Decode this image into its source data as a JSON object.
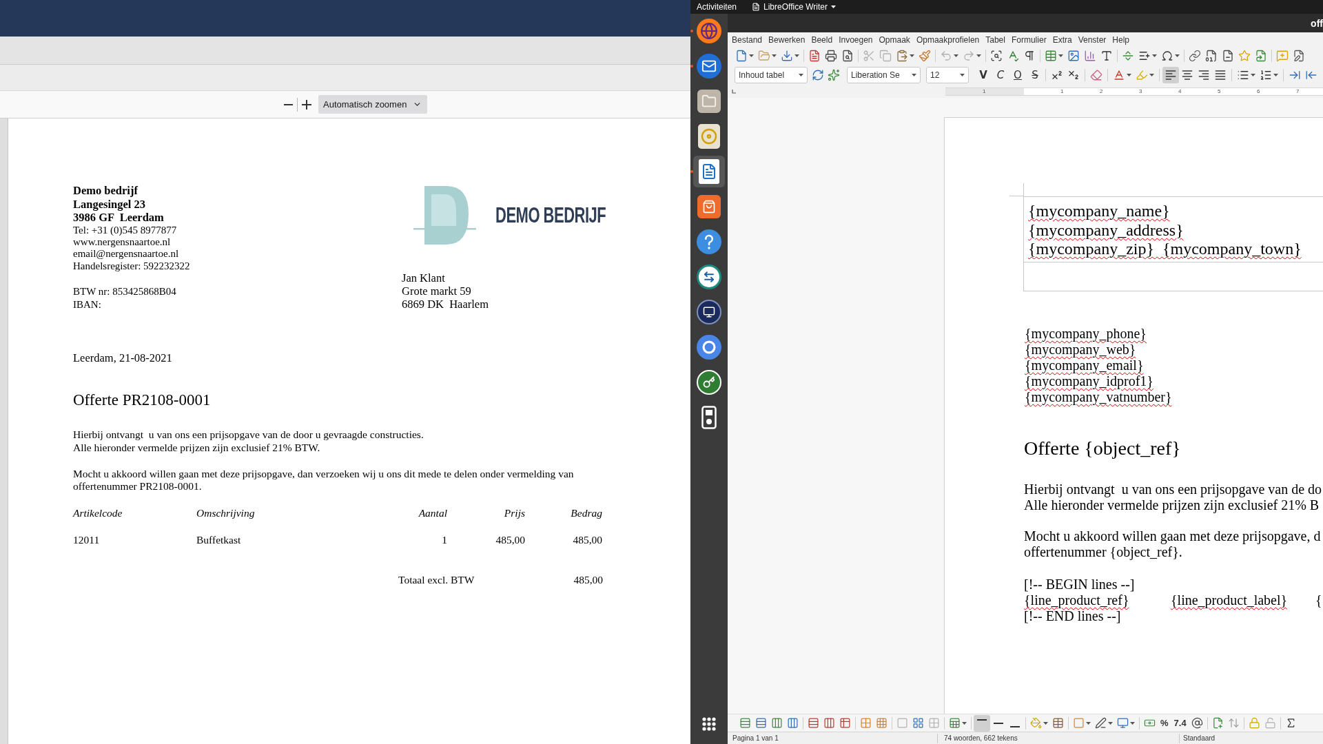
{
  "pdf_viewer": {
    "zoom_select": "Automatisch zoomen",
    "document": {
      "sender_lines": [
        {
          "text": "Demo bedrijf",
          "bold": true
        },
        {
          "text": "Langesingel 23",
          "bold": true
        },
        {
          "text": "3986 GF  Leerdam",
          "bold": true
        },
        {
          "text": "Tel: +31 (0)545 8977877",
          "bold": false
        },
        {
          "text": "www.nergensnaartoe.nl",
          "bold": false
        },
        {
          "text": "email@nergensnaartoe.nl",
          "bold": false
        },
        {
          "text": "Handelsregister: 592232322",
          "bold": false
        }
      ],
      "tax_lines": [
        "BTW nr: 853425868B04",
        "IBAN:"
      ],
      "logo_text": "DEMO BEDRIJF",
      "recipient_lines": [
        "Jan Klant",
        "Grote markt 59",
        "6869 DK  Haarlem"
      ],
      "date_line": "Leerdam, 21-08-2021",
      "title": "Offerte PR2108-0001",
      "paragraphs": [
        [
          "Hierbij ontvangt  u van ons een prijsopgave van de door u gevraagde constructies.",
          "Alle hieronder vermelde prijzen zijn exclusief 21% BTW."
        ],
        [
          "Mocht u akkoord willen gaan met deze prijsopgave, dan verzoeken wij u ons dit mede te delen onder vermelding van",
          "offertenummer PR2108-0001."
        ]
      ],
      "table": {
        "columns": [
          "Artikelcode",
          "Omschrijving",
          "Aantal",
          "Prijs",
          "Bedrag"
        ],
        "rows": [
          [
            "12011",
            "Buffetkast",
            "1",
            "485,00",
            "485,00"
          ]
        ],
        "total": {
          "label": "Totaal excl. BTW",
          "value": "485,00"
        }
      }
    }
  },
  "top_bar": {
    "activities": "Activiteiten",
    "app_menu": "LibreOffice Writer"
  },
  "dock": [
    {
      "kind": "browser",
      "running": true,
      "selected": false
    },
    {
      "kind": "mail",
      "running": true,
      "selected": false
    },
    {
      "kind": "files",
      "running": false,
      "selected": false
    },
    {
      "kind": "music",
      "running": false,
      "selected": false
    },
    {
      "kind": "writer",
      "running": true,
      "selected": true
    },
    {
      "kind": "store",
      "running": false,
      "selected": false
    },
    {
      "kind": "help",
      "running": false,
      "selected": false
    },
    {
      "kind": "remote",
      "running": false,
      "selected": false
    },
    {
      "kind": "commander",
      "running": false,
      "selected": false
    },
    {
      "kind": "web",
      "running": false,
      "selected": false
    },
    {
      "kind": "keys",
      "running": false,
      "selected": false
    },
    {
      "kind": "player",
      "running": false,
      "selected": false
    }
  ],
  "writer": {
    "title": "off",
    "menu": [
      "Bestand",
      "Bewerken",
      "Beeld",
      "Invoegen",
      "Opmaak",
      "Opmaakprofielen",
      "Tabel",
      "Formulier",
      "Extra",
      "Venster",
      "Help"
    ],
    "formatting_toolbar": {
      "paragraph_style": "Inhoud tabel",
      "font_name": "Liberation Se",
      "font_size": "12",
      "character_buttons": [
        "V",
        "C",
        "O",
        "S"
      ],
      "alignment": [
        {
          "selected": true
        },
        {
          "selected": false
        },
        {
          "selected": false
        },
        {
          "selected": false
        }
      ]
    },
    "ruler_labels": [
      "1",
      "1",
      "2",
      "3",
      "4",
      "5",
      "6",
      "7"
    ],
    "document": {
      "header_lines": [
        {
          "text": "{mycompany_name}",
          "flagged": true
        },
        {
          "text": "{mycompany_address}",
          "flagged": true
        },
        {
          "text": "{mycompany_zip}  {mycompany_town}",
          "flagged": true
        }
      ],
      "contact_lines": [
        {
          "text": "{mycompany_phone}",
          "flagged": true
        },
        {
          "text": "{mycompany_web}",
          "flagged": true
        },
        {
          "text": "{mycompany_email}",
          "flagged": true
        },
        {
          "text": "{mycompany_idprof1}",
          "flagged": true
        },
        {
          "text": "{mycompany_vatnumber}",
          "flagged": true
        }
      ],
      "title": "Offerte {object_ref}",
      "paragraphs": [
        [
          "Hierbij ontvangt  u van ons een prijsopgave van de do",
          "Alle hieronder vermelde prijzen zijn exclusief 21% B"
        ],
        [
          "Mocht u akkoord willen gaan met deze prijsopgave, d",
          "offertenummer {object_ref}."
        ]
      ],
      "lines_block": {
        "begin": "[!-- BEGIN lines --]",
        "cells": [
          {
            "text": "{line_product_ref}",
            "flagged": true
          },
          {
            "text": "{line_product_label}",
            "flagged": true
          },
          {
            "text": "{",
            "flagged": false
          }
        ],
        "end": "[!-- END lines --]"
      }
    },
    "table_toolbar": {
      "cell_alignment": [
        {
          "selected": true
        },
        {
          "selected": false
        },
        {
          "selected": false
        }
      ],
      "number_formats": [
        "%",
        "7.4"
      ]
    },
    "status_bar": [
      "Pagina 1 van 1",
      "74 woorden, 662 tekens",
      "Standaard"
    ]
  }
}
